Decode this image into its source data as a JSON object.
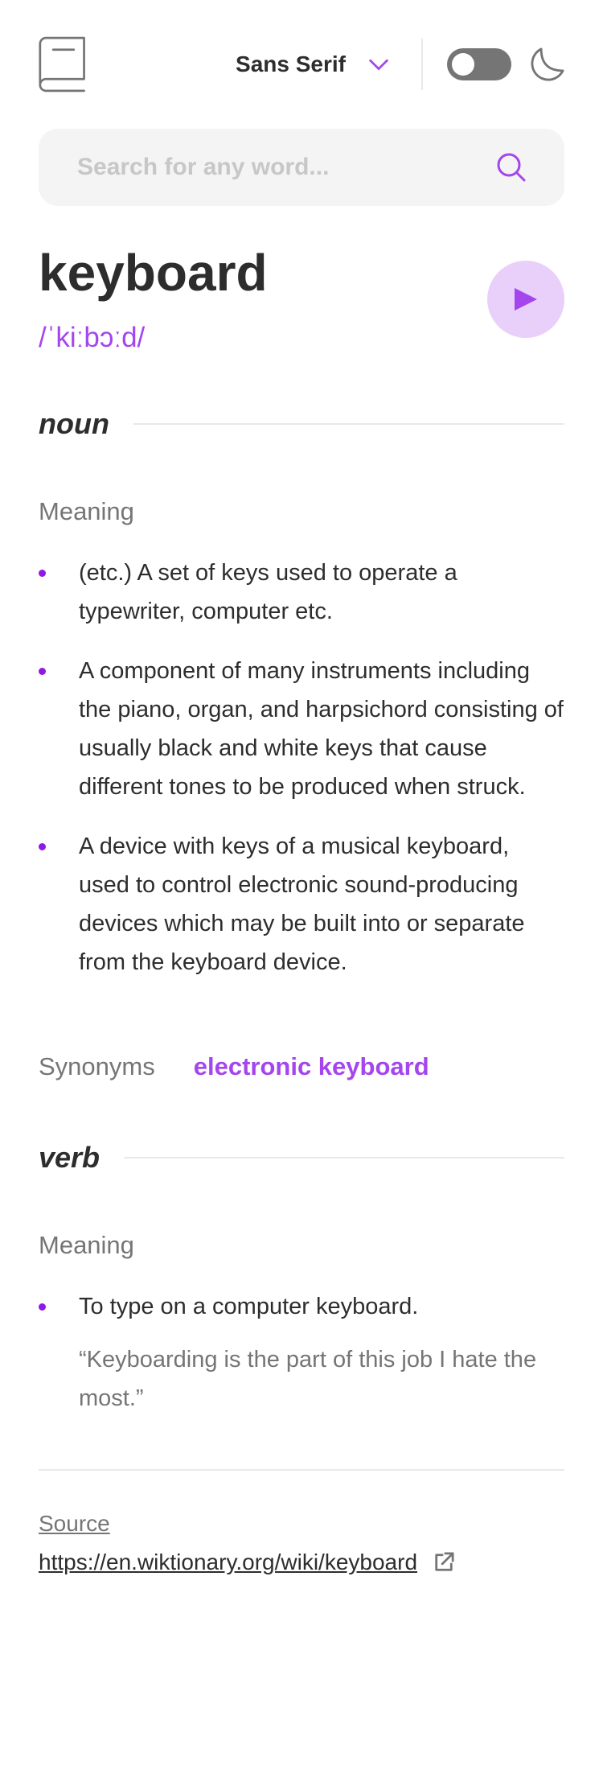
{
  "header": {
    "logo_icon": "book-icon",
    "font_label": "Sans Serif",
    "dropdown_icon": "chevron-down-icon",
    "theme_toggle_icon": "toggle-icon",
    "dark_mode_icon": "moon-icon"
  },
  "search": {
    "placeholder": "Search for any word...",
    "value": "",
    "icon": "search-icon"
  },
  "entry": {
    "word": "keyboard",
    "phonetic": "/ˈkiːbɔːd/",
    "play_icon": "play-icon"
  },
  "meanings": [
    {
      "part_of_speech": "noun",
      "heading": "Meaning",
      "definitions": [
        "(etc.) A set of keys used to operate a typewriter, computer etc.",
        "A component of many instruments including the piano, organ, and harpsichord consisting of usually black and white keys that cause different tones to be produced when struck.",
        "A device with keys of a musical keyboard, used to control electronic sound-producing devices which may be built into or separate from the keyboard device."
      ],
      "synonyms_label": "Synonyms",
      "synonyms": [
        "electronic keyboard"
      ]
    },
    {
      "part_of_speech": "verb",
      "heading": "Meaning",
      "definitions": [
        "To type on a computer keyboard."
      ],
      "example": "“Keyboarding is the part of this job I hate the most.”"
    }
  ],
  "source": {
    "label": "Source",
    "url": "https://en.wiktionary.org/wiki/keyboard",
    "icon": "external-link-icon"
  },
  "colors": {
    "accent": "#a445ed",
    "accent_light": "#e9d0fa",
    "text": "#2d2d2d",
    "muted": "#757575",
    "divider": "#e9e9e9",
    "search_bg": "#f4f4f4"
  }
}
